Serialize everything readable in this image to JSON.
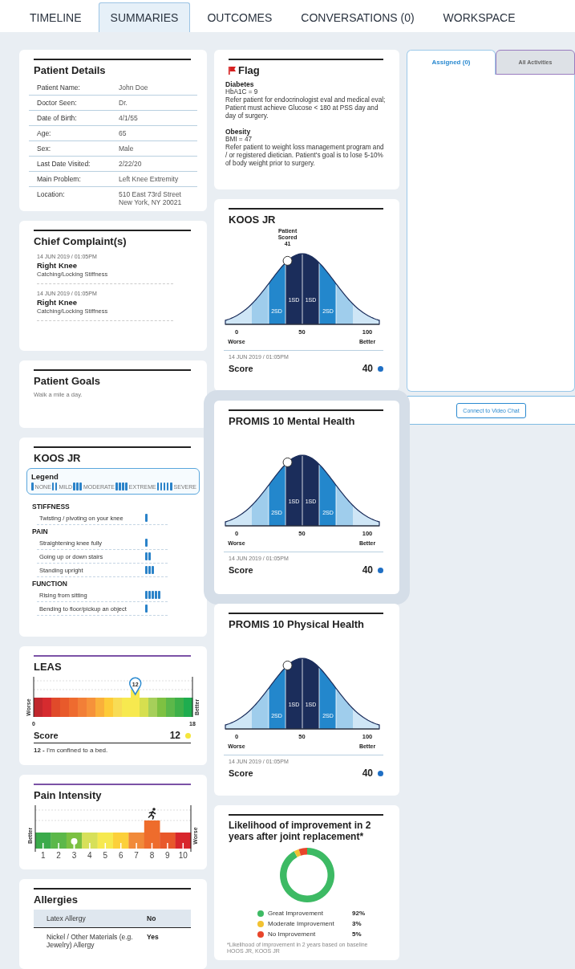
{
  "tabs": [
    {
      "label": "TIMELINE",
      "selected": false
    },
    {
      "label": "SUMMARIES",
      "selected": true
    },
    {
      "label": "OUTCOMES",
      "selected": false
    },
    {
      "label": "CONVERSATIONS (0)",
      "selected": false
    },
    {
      "label": "WORKSPACE",
      "selected": false
    }
  ],
  "patient_details": {
    "title": "Patient Details",
    "rows": [
      {
        "label": "Patient Name:",
        "value": "John Doe"
      },
      {
        "label": "Doctor Seen:",
        "value": "Dr."
      },
      {
        "label": "Date of Birth:",
        "value": "4/1/55"
      },
      {
        "label": "Age:",
        "value": "65"
      },
      {
        "label": "Sex:",
        "value": "Male"
      },
      {
        "label": "Last Date Visited:",
        "value": "2/22/20"
      },
      {
        "label": "Main Problem:",
        "value": "Left Knee Extremity"
      },
      {
        "label": "Location:",
        "value": "510 East 73rd Street\nNew York, NY 20021"
      }
    ]
  },
  "chief_complaints": {
    "title": "Chief Complaint(s)",
    "items": [
      {
        "timestamp": "14 JUN 2019 / 01:05PM",
        "title": "Right Knee",
        "detail": "Catching/Locking Stiffness"
      },
      {
        "timestamp": "14 JUN 2019 / 01:05PM",
        "title": "Right Knee",
        "detail": "Catching/Locking Stiffness"
      }
    ]
  },
  "patient_goals": {
    "title": "Patient Goals",
    "text": "Walk a mile a day."
  },
  "koos_summary": {
    "title": "KOOS JR",
    "legend": {
      "title": "Legend",
      "items": [
        {
          "label": "NONE",
          "kind": "none"
        },
        {
          "label": "MILD",
          "kind": "mild"
        },
        {
          "label": "MODERATE",
          "kind": "moderate"
        },
        {
          "label": "EXTREME",
          "kind": "extreme"
        },
        {
          "label": "SEVERE",
          "kind": "severe"
        }
      ]
    },
    "sections": [
      {
        "title": "STIFFNESS",
        "items": [
          {
            "label": "Twisting / pivoting on your knee",
            "kind": "none"
          }
        ]
      },
      {
        "title": "PAIN",
        "items": [
          {
            "label": "Straightening knee fully",
            "kind": "none"
          },
          {
            "label": "Going up or down stairs",
            "kind": "mild"
          },
          {
            "label": "Standing upright",
            "kind": "moderate"
          }
        ]
      },
      {
        "title": "FUNCTION",
        "items": [
          {
            "label": "Rising from sitting",
            "kind": "severe"
          },
          {
            "label": "Bending to floor/pickup an object",
            "kind": "none"
          }
        ]
      }
    ]
  },
  "leas": {
    "title": "LEAS",
    "marker": {
      "label": "12",
      "level": 0.64
    },
    "segments": [
      {
        "color": "#c1272d"
      },
      {
        "color": "#d62b2f"
      },
      {
        "color": "#e04a2a"
      },
      {
        "color": "#e85a2b"
      },
      {
        "color": "#ee6b2f"
      },
      {
        "color": "#f27f37"
      },
      {
        "color": "#f6923a"
      },
      {
        "color": "#fab03a"
      },
      {
        "color": "#fdcb38"
      },
      {
        "color": "#f8dc55"
      },
      {
        "color": "#f7e94f"
      },
      {
        "color": "#f7e94f"
      },
      {
        "color": "#d6df4f"
      },
      {
        "color": "#a6cf5a"
      },
      {
        "color": "#7ec142"
      },
      {
        "color": "#5cb84a"
      },
      {
        "color": "#3eb049"
      },
      {
        "color": "#1fad4f"
      }
    ],
    "axis_min": "0",
    "axis_max": "18",
    "low_caption": "Worse",
    "high_caption": "Better",
    "score": {
      "label": "Score",
      "value": "12",
      "color": "#f5e63c"
    },
    "description": "**12 -** I'm confined to a bed."
  },
  "pain_intensity": {
    "title": "Pain Intensity",
    "low_caption": "Better",
    "high_caption": "Worse",
    "levels": [
      {
        "label": "1",
        "color": "#3aaa4a",
        "marked": false,
        "raised": false
      },
      {
        "label": "2",
        "color": "#5cb84a",
        "marked": false,
        "raised": false
      },
      {
        "label": "3",
        "color": "#7cc142",
        "marked": true,
        "raised": false
      },
      {
        "label": "4",
        "color": "#d7e05a",
        "marked": false,
        "raised": false
      },
      {
        "label": "5",
        "color": "#f6e94f",
        "marked": false,
        "raised": false
      },
      {
        "label": "6",
        "color": "#fcd03a",
        "marked": false,
        "raised": false
      },
      {
        "label": "7",
        "color": "#f18a3a",
        "marked": false,
        "raised": false
      },
      {
        "label": "8",
        "color": "#ee6c2c",
        "marked": false,
        "raised": true
      },
      {
        "label": "9",
        "color": "#e8582b",
        "marked": false,
        "raised": false
      },
      {
        "label": "10",
        "color": "#d8262c",
        "marked": false,
        "raised": false
      }
    ]
  },
  "allergies": {
    "title": "Allergies",
    "rows": [
      {
        "name": "Latex Allergy",
        "value": "No"
      },
      {
        "name": "Nickel / Other Materials (e.g. Jewelry) Allergy",
        "value": "Yes"
      }
    ]
  },
  "flag": {
    "title": "Flag",
    "items": [
      {
        "condition": "Diabetes",
        "measure": "HbA1C = 9",
        "note": "Refer patient for endocrinologist eval and medical eval; Patient must achieve Glucose < 180 at PSS day and day of surgery."
      },
      {
        "condition": "Obesity",
        "measure": "BMI = 47",
        "note": "Refer patient to weight loss management program and / or registered dietician. Patient's goal is to lose 5-10% of body weight prior to surgery."
      }
    ]
  },
  "outcome_cards": [
    {
      "title": "KOOS JR",
      "highlighted": false,
      "marker_label": "Patient Scored",
      "marker_value": "41",
      "level": 0.39,
      "band_labels": [
        "2SD",
        "1SD",
        "1SD",
        "2SD"
      ],
      "axis": [
        {
          "value": "0",
          "caption": "Worse"
        },
        {
          "value": "50"
        },
        {
          "value": "100",
          "caption": "Better"
        }
      ],
      "timestamp": "14 JUN 2019 / 01:05PM",
      "score": {
        "label": "Score",
        "value": "40",
        "color": "#1f6fc4"
      }
    },
    {
      "title": "PROMIS 10 Mental Health",
      "highlighted": true,
      "level": 0.39,
      "band_labels": [
        "2SD",
        "1SD",
        "1SD",
        "2SD"
      ],
      "axis": [
        {
          "value": "0",
          "caption": "Worse"
        },
        {
          "value": "50"
        },
        {
          "value": "100",
          "caption": "Better"
        }
      ],
      "timestamp": "14 JUN 2019 / 01:05PM",
      "score": {
        "label": "Score",
        "value": "40",
        "color": "#1f6fc4"
      }
    },
    {
      "title": "PROMIS 10 Physical Health",
      "highlighted": false,
      "level": 0.39,
      "band_labels": [
        "2SD",
        "1SD",
        "1SD",
        "2SD"
      ],
      "axis": [
        {
          "value": "0",
          "caption": "Worse"
        },
        {
          "value": "50"
        },
        {
          "value": "100",
          "caption": "Better"
        }
      ],
      "timestamp": "14 JUN 2019 / 01:05PM",
      "score": {
        "label": "Score",
        "value": "40",
        "color": "#1f6fc4"
      }
    }
  ],
  "likelihood": {
    "title": "Likelihood of improvement in 2 years after joint replacement*",
    "chart_data": {
      "type": "donut",
      "categories": [
        "Great Improvement",
        "Moderate Improvement",
        "No Improvement"
      ],
      "values": [
        92,
        3,
        5
      ]
    },
    "legend": [
      {
        "value": "92%",
        "color": "#3dba64"
      },
      {
        "value": "3%",
        "color": "#f2c232"
      },
      {
        "value": "5%",
        "color": "#e8452a"
      }
    ],
    "footnote": "*Likelihood of improvement in 2 years based on baseline HOOS JR, KOOS JR"
  },
  "activities": {
    "tabs": [
      {
        "label": "Assigned (0)",
        "selected": true
      },
      {
        "label": "All Activities",
        "selected": false
      }
    ],
    "video_button": "Connect to Video Chat"
  }
}
